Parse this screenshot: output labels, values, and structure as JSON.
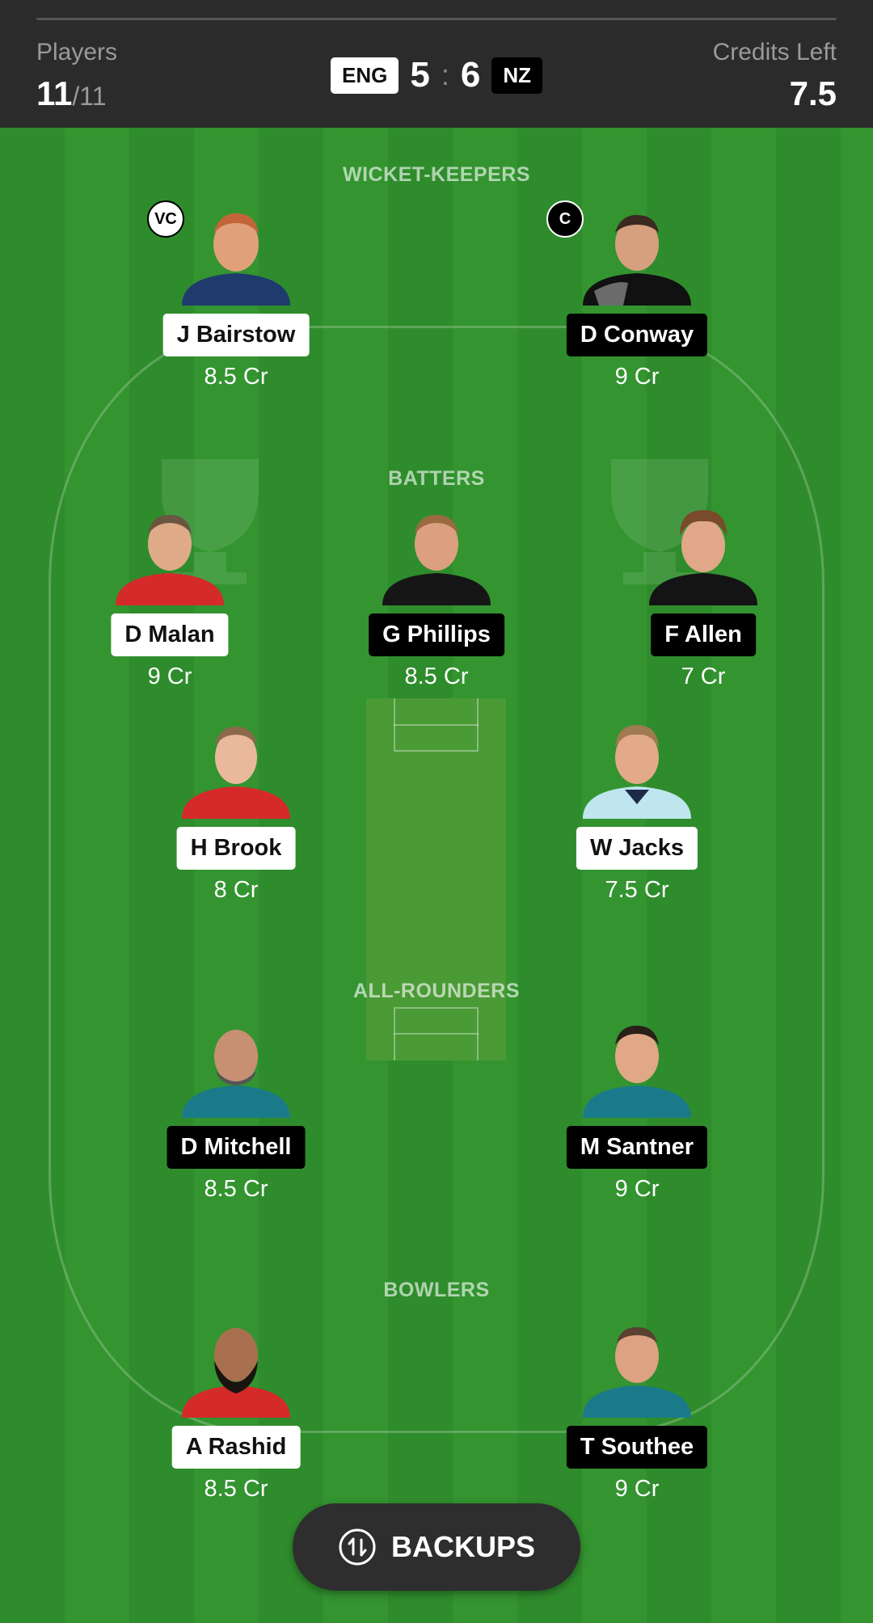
{
  "header": {
    "players_label": "Players",
    "players_count": "11",
    "players_max": "/11",
    "credits_label": "Credits Left",
    "credits_value": "7.5",
    "team_left": "ENG",
    "team_right": "NZ",
    "score_left": "5",
    "score_sep": ":",
    "score_right": "6"
  },
  "sections": {
    "wicket_keepers": "WICKET-KEEPERS",
    "batters": "BATTERS",
    "all_rounders": "ALL-ROUNDERS",
    "bowlers": "BOWLERS"
  },
  "badges": {
    "vice_captain": "VC",
    "captain": "C"
  },
  "players": {
    "bairstow": {
      "name": "J Bairstow",
      "credit": "8.5 Cr",
      "team": "ENG"
    },
    "conway": {
      "name": "D Conway",
      "credit": "9 Cr",
      "team": "NZ"
    },
    "malan": {
      "name": "D Malan",
      "credit": "9 Cr",
      "team": "ENG"
    },
    "phillips": {
      "name": "G Phillips",
      "credit": "8.5 Cr",
      "team": "NZ"
    },
    "allen": {
      "name": "F Allen",
      "credit": "7 Cr",
      "team": "NZ"
    },
    "brook": {
      "name": "H Brook",
      "credit": "8 Cr",
      "team": "ENG"
    },
    "jacks": {
      "name": "W Jacks",
      "credit": "7.5 Cr",
      "team": "ENG"
    },
    "mitchell": {
      "name": "D Mitchell",
      "credit": "8.5 Cr",
      "team": "NZ"
    },
    "santner": {
      "name": "M Santner",
      "credit": "9 Cr",
      "team": "NZ"
    },
    "rashid": {
      "name": "A Rashid",
      "credit": "8.5 Cr",
      "team": "ENG"
    },
    "southee": {
      "name": "T Southee",
      "credit": "9 Cr",
      "team": "NZ"
    }
  },
  "backups_button": {
    "label": "BACKUPS",
    "icon": "swap-icon"
  },
  "colors": {
    "field": "#2f8c2c",
    "header": "#2b2b2b",
    "eng_tag": "#ffffff",
    "nz_tag": "#000000"
  }
}
